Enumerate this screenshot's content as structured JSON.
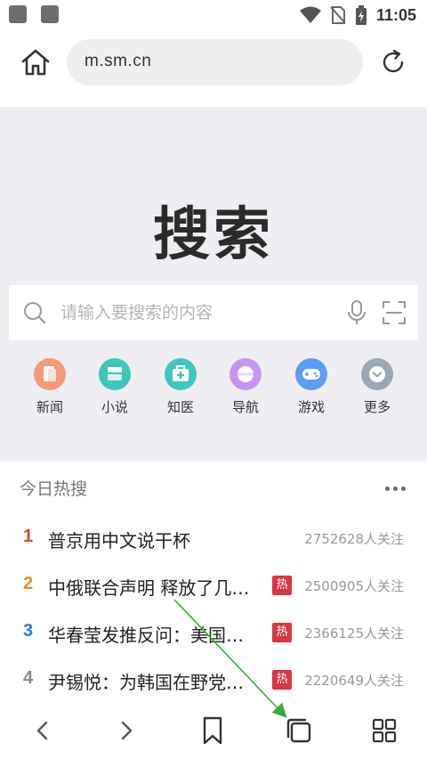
{
  "status_bar": {
    "time": "11:05"
  },
  "address_bar": {
    "url": "m.sm.cn"
  },
  "search": {
    "logo": "搜索",
    "placeholder": "请输入要搜索的内容"
  },
  "quick_links": [
    {
      "label": "新闻",
      "color": "#f59a77",
      "icon": "news-icon"
    },
    {
      "label": "小说",
      "color": "#3ec7b8",
      "icon": "book-icon"
    },
    {
      "label": "知医",
      "color": "#3ec7c0",
      "icon": "medical-kit-icon"
    },
    {
      "label": "导航",
      "color": "#c795f0",
      "icon": "compass-icon"
    },
    {
      "label": "游戏",
      "color": "#5b9df5",
      "icon": "gamepad-icon"
    },
    {
      "label": "更多",
      "color": "#9aa8b6",
      "icon": "chevron-down-icon"
    }
  ],
  "hot": {
    "title": "今日热搜",
    "items": [
      {
        "rank": "1",
        "rank_color": "#e8412f",
        "title": "普京用中文说干杯",
        "badge": "",
        "count": "2752628人关注"
      },
      {
        "rank": "2",
        "rank_color": "#f08a24",
        "title": "中俄联合声明 释放了几…",
        "badge": "热",
        "count": "2500905人关注"
      },
      {
        "rank": "3",
        "rank_color": "#2f7fe0",
        "title": "华春莹发推反问：美国…",
        "badge": "热",
        "count": "2366125人关注"
      },
      {
        "rank": "4",
        "rank_color": "#888888",
        "title": "尹锡悦：为韩国在野党…",
        "badge": "热",
        "count": "2220649人关注"
      }
    ]
  },
  "colors": {
    "annotation_arrow": "#3aaa35",
    "hot_badge": "#d9363e"
  }
}
